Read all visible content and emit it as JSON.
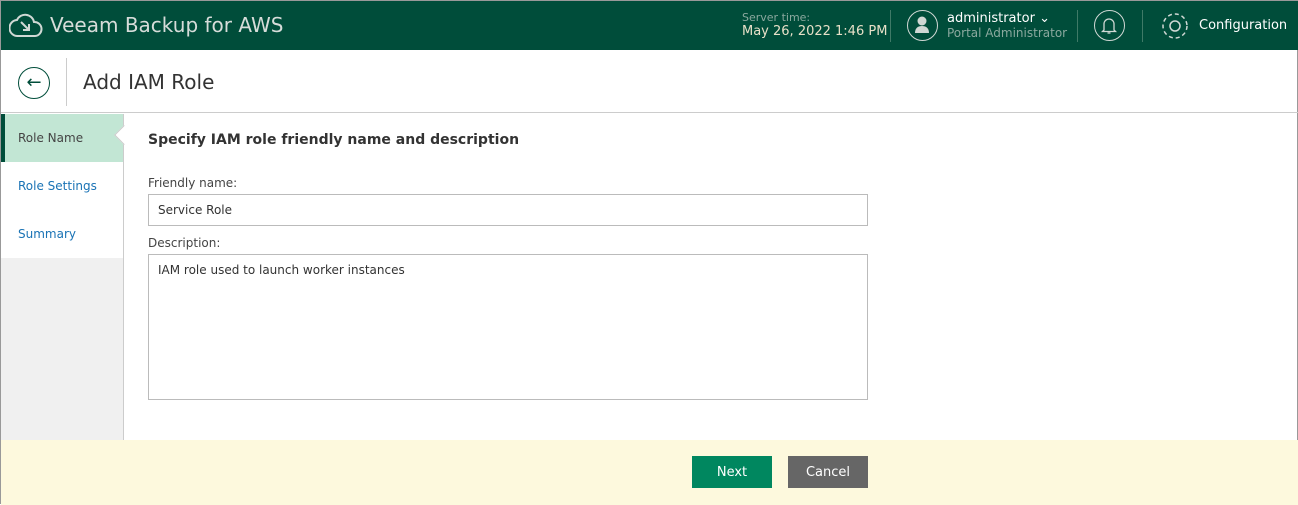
{
  "app": {
    "title": "Veeam Backup for AWS"
  },
  "topbar": {
    "server_time_label": "Server time:",
    "server_time": "May 26, 2022 1:46 PM",
    "user_name": "administrator",
    "user_role": "Portal Administrator",
    "configuration": "Configuration"
  },
  "page": {
    "title": "Add IAM Role"
  },
  "steps": [
    {
      "label": "Role Name"
    },
    {
      "label": "Role Settings"
    },
    {
      "label": "Summary"
    }
  ],
  "form": {
    "heading": "Specify IAM role friendly name and description",
    "friendly_name_label": "Friendly name:",
    "friendly_name": "Service Role",
    "description_label": "Description:",
    "description": "IAM role used to launch worker instances"
  },
  "footer": {
    "next": "Next",
    "cancel": "Cancel"
  }
}
